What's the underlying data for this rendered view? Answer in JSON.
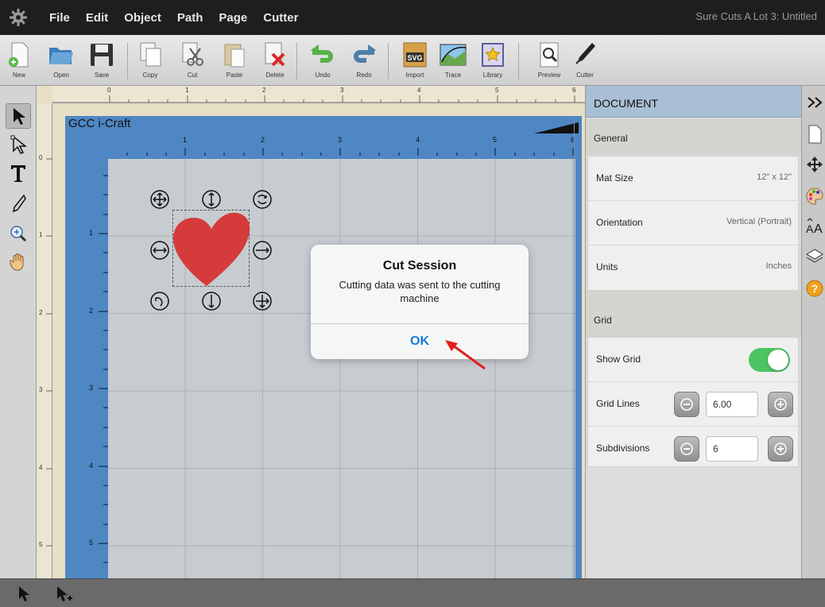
{
  "menubar": {
    "items": [
      "File",
      "Edit",
      "Object",
      "Path",
      "Page",
      "Cutter"
    ],
    "app_title": "Sure Cuts A Lot 3: Untitled"
  },
  "toolbar": {
    "new": "New",
    "open": "Open",
    "save": "Save",
    "copy": "Copy",
    "cut": "Cut",
    "paste": "Paste",
    "delete": "Delete",
    "undo": "Undo",
    "redo": "Redo",
    "import": "Import",
    "trace": "Trace",
    "library": "Library",
    "preview": "Preview",
    "cutter": "Cutter"
  },
  "canvas": {
    "mat_title": "GCC i-Craft",
    "ruler_top": [
      "0",
      "1",
      "2",
      "3",
      "4",
      "5",
      "6"
    ],
    "mat_ruler_top": [
      "1",
      "2",
      "3",
      "4",
      "5",
      "6"
    ],
    "ruler_left": [
      "0",
      "1",
      "2",
      "3",
      "4",
      "5"
    ],
    "mat_ruler_left": [
      "1",
      "2",
      "3",
      "4",
      "5"
    ],
    "object_color": "#d63b3b"
  },
  "dialog": {
    "title": "Cut Session",
    "message": "Cutting data was sent to the cutting machine",
    "ok": "OK"
  },
  "panel": {
    "header": "DOCUMENT",
    "general": "General",
    "mat_size_label": "Mat Size",
    "mat_size_value": "12\" x 12\"",
    "orientation_label": "Orientation",
    "orientation_value": "Vertical (Portrait)",
    "units_label": "Units",
    "units_value": "Inches",
    "grid": "Grid",
    "show_grid_label": "Show Grid",
    "show_grid_on": true,
    "grid_lines_label": "Grid Lines",
    "grid_lines_value": "6.00",
    "subdivisions_label": "Subdivisions",
    "subdivisions_value": "6"
  },
  "colors": {
    "accent": "#1a7bd6",
    "toggle_on": "#4cc462",
    "mat_blue": "#4f87c4",
    "panel_header": "#a9bfd6"
  }
}
